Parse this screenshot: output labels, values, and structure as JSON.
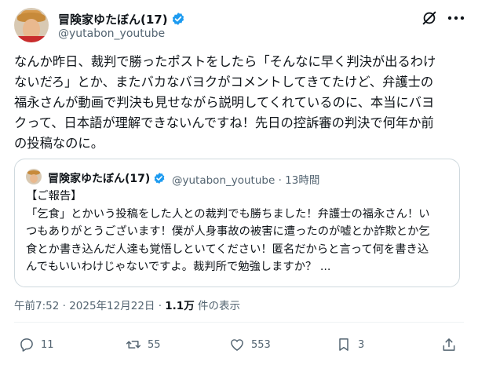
{
  "post": {
    "display_name": "冒険家ゆたぼん(17)",
    "handle": "@yutabon_youtube",
    "body_lines": [
      "なんか昨日、裁判で勝ったポストをしたら「そんなに早く判決が出るわけ",
      "ないだろ」とか、またバカなバヨクがコメントしてきてたけど、弁護士の",
      "福永さんが動画で判決も見せながら説明してくれているのに、本当にバヨ",
      "クって、日本語が理解できないんですね！先日の控訴審の判決で何年か前",
      "の投稿なのに。"
    ],
    "quoted": {
      "display_name": "冒険家ゆたぼん(17)",
      "handle_time": "@yutabon_youtube · 13時間",
      "body_lines": [
        "【ご報告】",
        "「乞食」とかいう投稿をした人との裁判でも勝ちました！弁護士の福永さん！い",
        "つもありがとうございます！僕が人身事故の被害に遭ったのが嘘とか詐欺とか乞",
        "食とか書き込んだ人達も覚悟しといてください！匿名だからと言って何を書き込",
        "んでもいいわけじゃないですよ。裁判所で勉強しますか？ ..."
      ]
    },
    "meta": {
      "time_date": "午前7:52 · 2025年12月22日 · ",
      "views_count": "1.1万",
      "views_label": " 件の表示"
    },
    "actions": {
      "replies": "11",
      "reposts": "55",
      "likes": "553",
      "bookmarks": "3"
    }
  },
  "colors": {
    "verified": "#1d9bf0",
    "text": "#0f1419",
    "muted": "#536471",
    "border": "#cfd9de"
  },
  "icons": [
    "verified-badge-icon",
    "grok-icon",
    "more-icon",
    "reply-icon",
    "repost-icon",
    "like-icon",
    "bookmark-icon",
    "share-icon"
  ]
}
